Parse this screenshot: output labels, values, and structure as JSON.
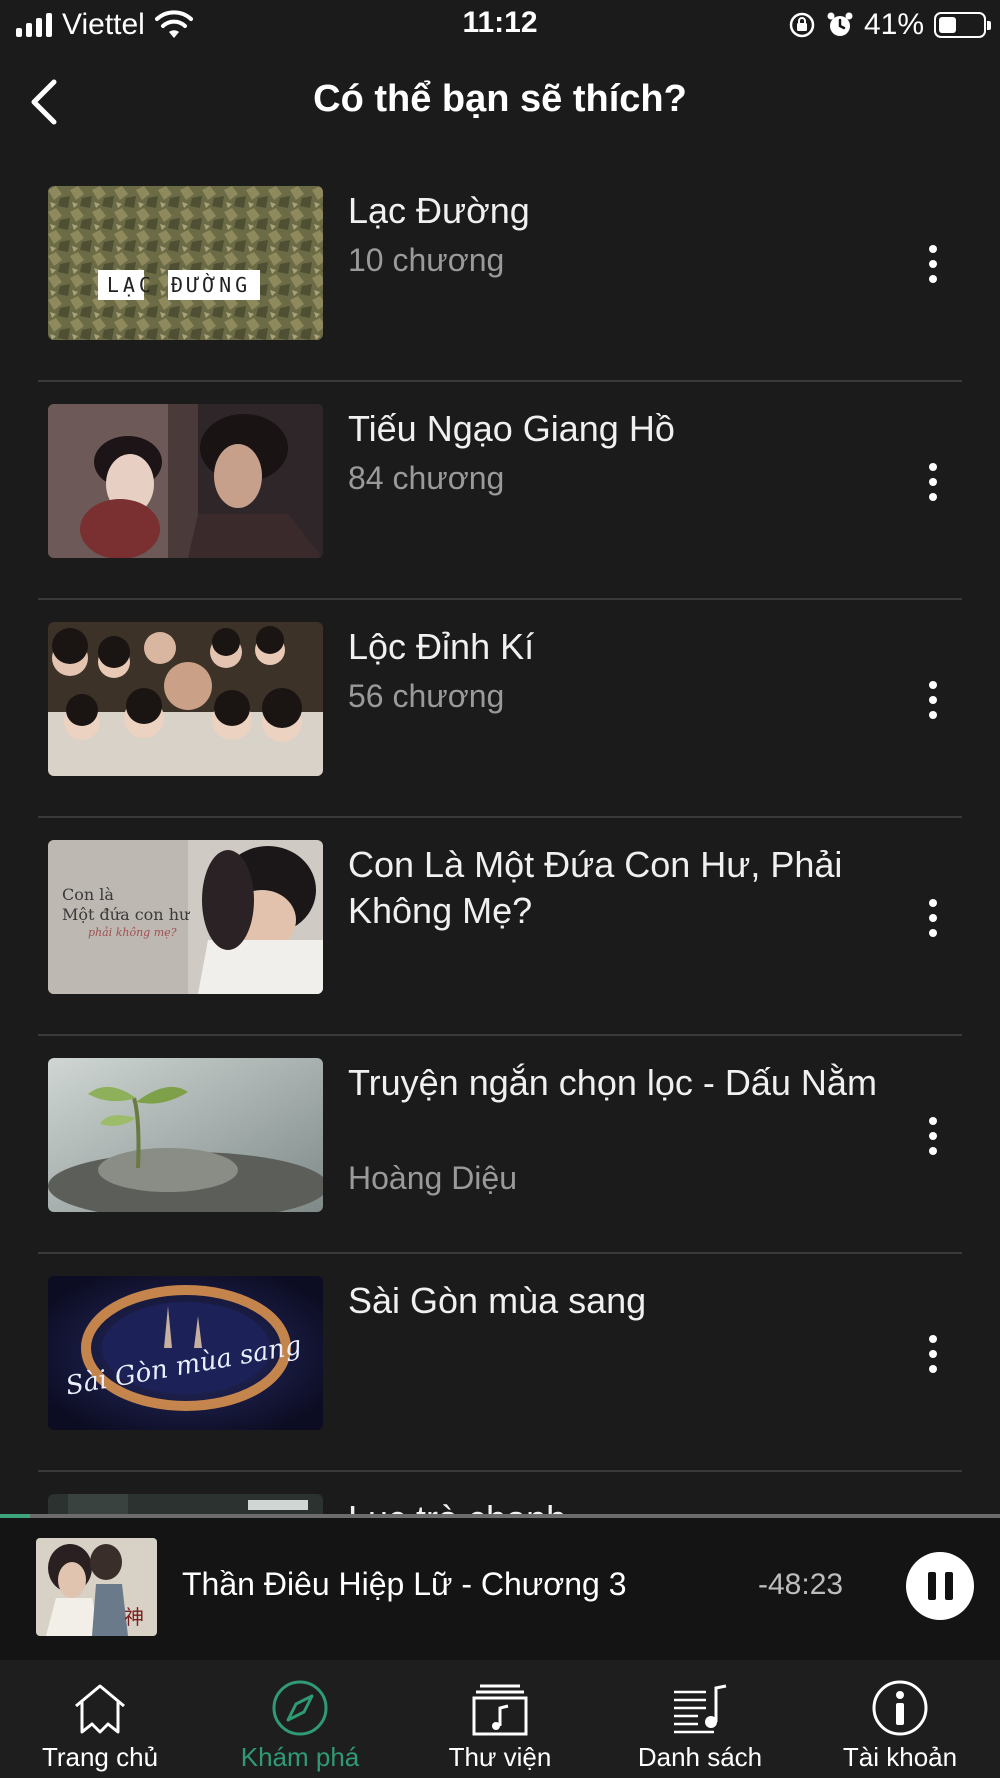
{
  "status_bar": {
    "carrier": "Viettel",
    "time": "11:12",
    "battery_percent": "41%",
    "battery_level": 0.41,
    "icons": [
      "signal-icon",
      "wifi-icon",
      "orientation-lock-icon",
      "alarm-icon",
      "battery-icon"
    ]
  },
  "header": {
    "title": "Có thể bạn sẽ thích?",
    "back_icon": "chevron-left-icon"
  },
  "items": [
    {
      "title": "Lạc Đường",
      "subtitle": "10 chương",
      "thumb_text": "LẠC ĐƯỜNG"
    },
    {
      "title": "Tiếu Ngạo Giang Hồ",
      "subtitle": "84 chương"
    },
    {
      "title": "Lộc Đỉnh Kí",
      "subtitle": "56 chương"
    },
    {
      "title": "Con Là Một Đứa Con Hư, Phải Không Mẹ?",
      "subtitle": "",
      "thumb_text_1": "Con là",
      "thumb_text_2": "Một đứa con hư",
      "thumb_text_3": "phải không mẹ?"
    },
    {
      "title": "Truyện ngắn chọn lọc - Dấu Nằm",
      "subtitle": "Hoàng Diệu"
    },
    {
      "title": "Sài Gòn mùa sang",
      "subtitle": "",
      "thumb_text": "Sài Gòn mùa sang"
    },
    {
      "title": "Lục trà chanh",
      "subtitle": ""
    }
  ],
  "now_playing": {
    "title": "Thần Điêu Hiệp Lữ - Chương 3",
    "remaining": "-48:23",
    "progress": 0.03,
    "state_icon": "pause-icon"
  },
  "tabs": [
    {
      "label": "Trang chủ",
      "icon": "home-icon",
      "active": false
    },
    {
      "label": "Khám phá",
      "icon": "compass-icon",
      "active": true
    },
    {
      "label": "Thư viện",
      "icon": "library-icon",
      "active": false
    },
    {
      "label": "Danh sách",
      "icon": "playlist-icon",
      "active": false
    },
    {
      "label": "Tài khoản",
      "icon": "info-icon",
      "active": false
    }
  ],
  "colors": {
    "background": "#1b1b1b",
    "accent": "#2f9a73",
    "subtitle": "#9a9a9a"
  }
}
